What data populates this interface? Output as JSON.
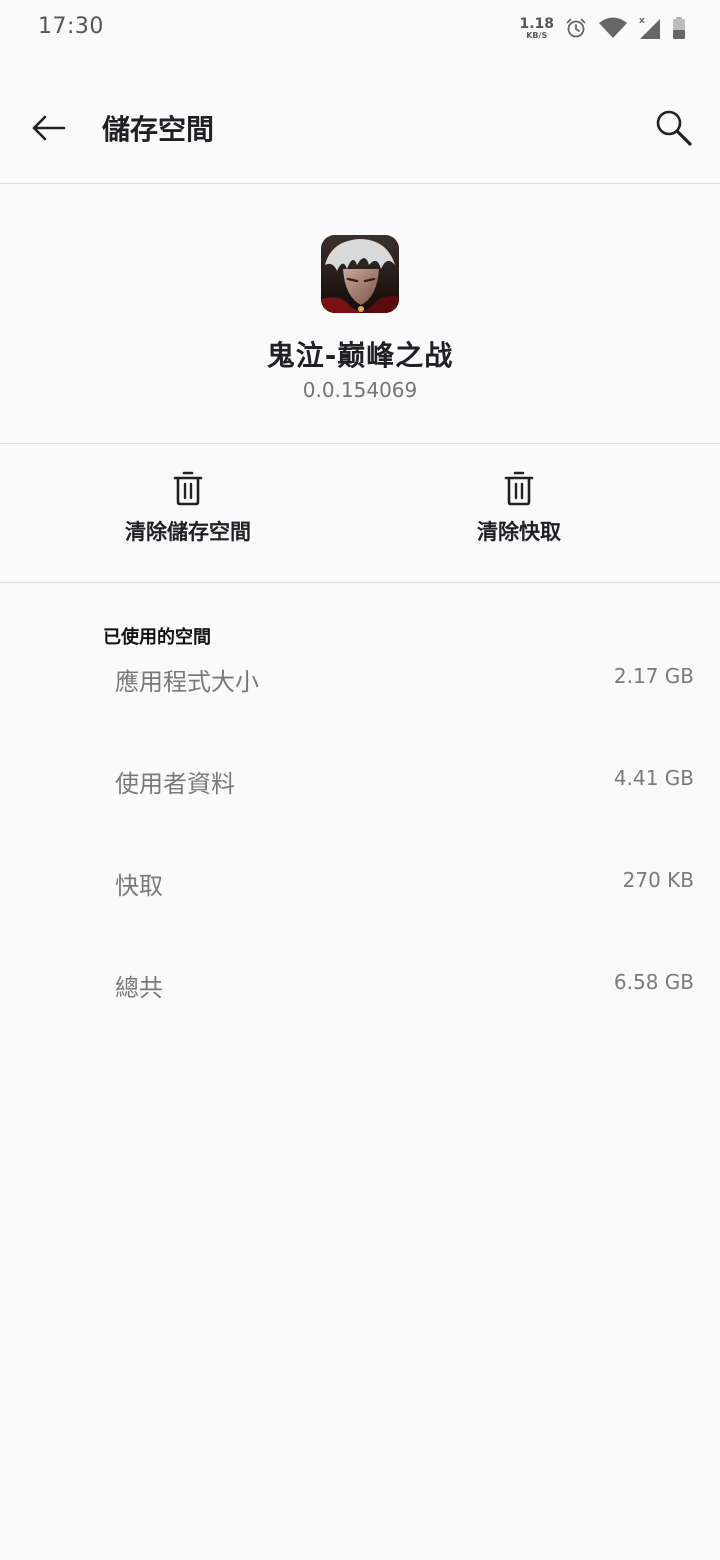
{
  "status_bar": {
    "time": "17:30",
    "net_speed": "1.18",
    "net_unit": "KB/S",
    "icons": [
      "alarm-icon",
      "wifi-icon",
      "cell-signal-icon",
      "battery-icon"
    ]
  },
  "app_bar": {
    "title": "儲存空間",
    "back_icon": "arrow-left-icon",
    "search_icon": "search-icon"
  },
  "app": {
    "name": "鬼泣-巅峰之战",
    "version": "0.0.154069"
  },
  "actions": {
    "clear_storage_label": "清除儲存空間",
    "clear_cache_label": "清除快取"
  },
  "storage": {
    "section_title": "已使用的空間",
    "rows": [
      {
        "label": "應用程式大小",
        "value": "2.17 GB"
      },
      {
        "label": "使用者資料",
        "value": "4.41 GB"
      },
      {
        "label": "快取",
        "value": "270 KB"
      },
      {
        "label": "總共",
        "value": "6.58 GB"
      }
    ]
  },
  "colors": {
    "background": "#fafafa",
    "divider": "#dcdcdc",
    "primary_text": "#202124",
    "secondary_text": "#7a7a7a"
  }
}
